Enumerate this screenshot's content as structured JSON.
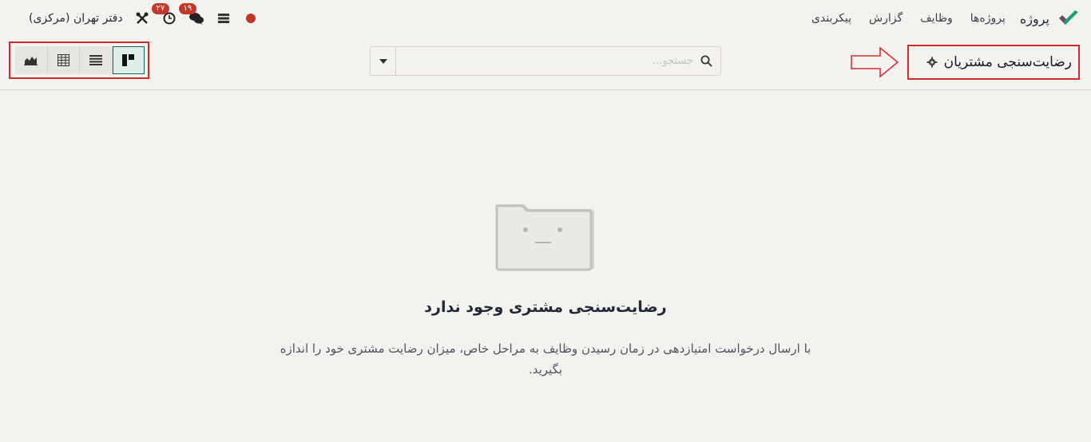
{
  "navbar": {
    "app_name": "پروژه",
    "menu": [
      "پروژه‌ها",
      "وظایف",
      "گزارش",
      "پیکربندی"
    ],
    "company": "دفتر تهران (مرکزی)",
    "messages_badge": "۱۹",
    "activities_badge": "۲۷",
    "icons": [
      "app-logo-icon",
      "tools-icon",
      "clock-icon",
      "chat-icon",
      "server-icon",
      "record-dot-icon"
    ],
    "colors": {
      "badge": "#c0392b",
      "logo_green": "#1e9c7a",
      "logo_purple": "#6b4a65"
    }
  },
  "control_panel": {
    "title": "رضایت‌سنجی مشتریان",
    "search_placeholder": "جستجو...",
    "views": [
      "kanban-view",
      "list-view",
      "pivot-view",
      "graph-view"
    ],
    "active_view": "kanban-view",
    "annotation_color": "#d12c2c"
  },
  "empty_state": {
    "title": "رضایت‌سنجی مشتری وجود ندارد",
    "description": "با ارسال درخواست امتیازدهی در زمان رسیدن وظایف به مراحل خاص، میزان رضایت مشتری خود را اندازه بگیرید."
  }
}
